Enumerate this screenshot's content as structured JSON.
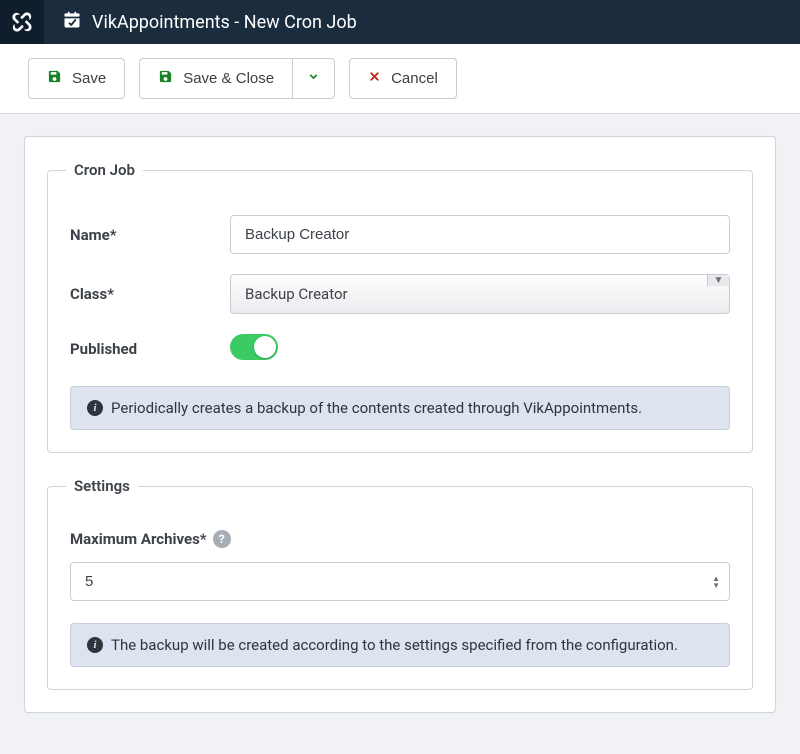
{
  "header": {
    "title": "VikAppointments - New Cron Job"
  },
  "toolbar": {
    "save_label": "Save",
    "save_close_label": "Save & Close",
    "cancel_label": "Cancel"
  },
  "cronjob": {
    "legend": "Cron Job",
    "name_label": "Name*",
    "name_value": "Backup Creator",
    "class_label": "Class*",
    "class_value": "Backup Creator",
    "published_label": "Published",
    "info_text": "Periodically creates a backup of the contents created through VikAppointments."
  },
  "settings": {
    "legend": "Settings",
    "max_archives_label": "Maximum Archives*",
    "max_archives_value": "5",
    "info_text": "The backup will be created according to the settings specified from the configuration."
  }
}
